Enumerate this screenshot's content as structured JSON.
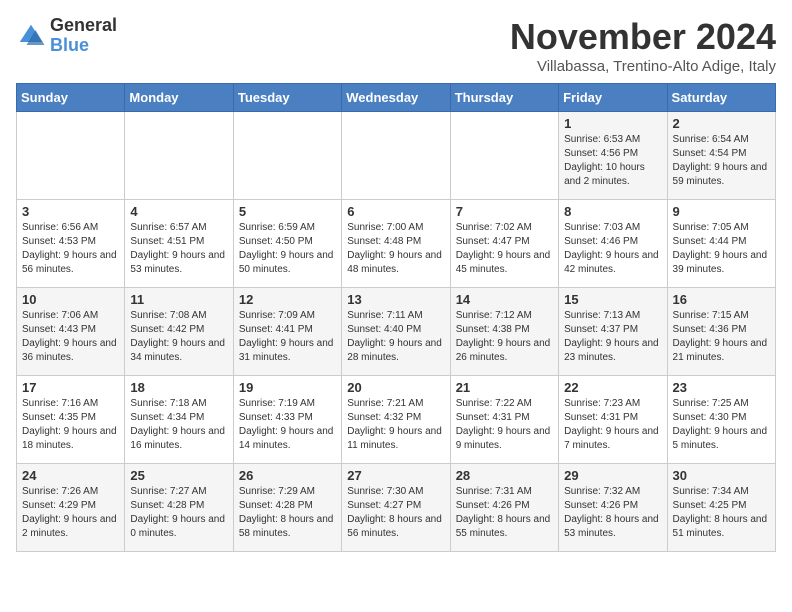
{
  "logo": {
    "general": "General",
    "blue": "Blue"
  },
  "title": "November 2024",
  "subtitle": "Villabassa, Trentino-Alto Adige, Italy",
  "days_header": [
    "Sunday",
    "Monday",
    "Tuesday",
    "Wednesday",
    "Thursday",
    "Friday",
    "Saturday"
  ],
  "weeks": [
    [
      {
        "day": "",
        "info": ""
      },
      {
        "day": "",
        "info": ""
      },
      {
        "day": "",
        "info": ""
      },
      {
        "day": "",
        "info": ""
      },
      {
        "day": "",
        "info": ""
      },
      {
        "day": "1",
        "info": "Sunrise: 6:53 AM\nSunset: 4:56 PM\nDaylight: 10 hours and 2 minutes."
      },
      {
        "day": "2",
        "info": "Sunrise: 6:54 AM\nSunset: 4:54 PM\nDaylight: 9 hours and 59 minutes."
      }
    ],
    [
      {
        "day": "3",
        "info": "Sunrise: 6:56 AM\nSunset: 4:53 PM\nDaylight: 9 hours and 56 minutes."
      },
      {
        "day": "4",
        "info": "Sunrise: 6:57 AM\nSunset: 4:51 PM\nDaylight: 9 hours and 53 minutes."
      },
      {
        "day": "5",
        "info": "Sunrise: 6:59 AM\nSunset: 4:50 PM\nDaylight: 9 hours and 50 minutes."
      },
      {
        "day": "6",
        "info": "Sunrise: 7:00 AM\nSunset: 4:48 PM\nDaylight: 9 hours and 48 minutes."
      },
      {
        "day": "7",
        "info": "Sunrise: 7:02 AM\nSunset: 4:47 PM\nDaylight: 9 hours and 45 minutes."
      },
      {
        "day": "8",
        "info": "Sunrise: 7:03 AM\nSunset: 4:46 PM\nDaylight: 9 hours and 42 minutes."
      },
      {
        "day": "9",
        "info": "Sunrise: 7:05 AM\nSunset: 4:44 PM\nDaylight: 9 hours and 39 minutes."
      }
    ],
    [
      {
        "day": "10",
        "info": "Sunrise: 7:06 AM\nSunset: 4:43 PM\nDaylight: 9 hours and 36 minutes."
      },
      {
        "day": "11",
        "info": "Sunrise: 7:08 AM\nSunset: 4:42 PM\nDaylight: 9 hours and 34 minutes."
      },
      {
        "day": "12",
        "info": "Sunrise: 7:09 AM\nSunset: 4:41 PM\nDaylight: 9 hours and 31 minutes."
      },
      {
        "day": "13",
        "info": "Sunrise: 7:11 AM\nSunset: 4:40 PM\nDaylight: 9 hours and 28 minutes."
      },
      {
        "day": "14",
        "info": "Sunrise: 7:12 AM\nSunset: 4:38 PM\nDaylight: 9 hours and 26 minutes."
      },
      {
        "day": "15",
        "info": "Sunrise: 7:13 AM\nSunset: 4:37 PM\nDaylight: 9 hours and 23 minutes."
      },
      {
        "day": "16",
        "info": "Sunrise: 7:15 AM\nSunset: 4:36 PM\nDaylight: 9 hours and 21 minutes."
      }
    ],
    [
      {
        "day": "17",
        "info": "Sunrise: 7:16 AM\nSunset: 4:35 PM\nDaylight: 9 hours and 18 minutes."
      },
      {
        "day": "18",
        "info": "Sunrise: 7:18 AM\nSunset: 4:34 PM\nDaylight: 9 hours and 16 minutes."
      },
      {
        "day": "19",
        "info": "Sunrise: 7:19 AM\nSunset: 4:33 PM\nDaylight: 9 hours and 14 minutes."
      },
      {
        "day": "20",
        "info": "Sunrise: 7:21 AM\nSunset: 4:32 PM\nDaylight: 9 hours and 11 minutes."
      },
      {
        "day": "21",
        "info": "Sunrise: 7:22 AM\nSunset: 4:31 PM\nDaylight: 9 hours and 9 minutes."
      },
      {
        "day": "22",
        "info": "Sunrise: 7:23 AM\nSunset: 4:31 PM\nDaylight: 9 hours and 7 minutes."
      },
      {
        "day": "23",
        "info": "Sunrise: 7:25 AM\nSunset: 4:30 PM\nDaylight: 9 hours and 5 minutes."
      }
    ],
    [
      {
        "day": "24",
        "info": "Sunrise: 7:26 AM\nSunset: 4:29 PM\nDaylight: 9 hours and 2 minutes."
      },
      {
        "day": "25",
        "info": "Sunrise: 7:27 AM\nSunset: 4:28 PM\nDaylight: 9 hours and 0 minutes."
      },
      {
        "day": "26",
        "info": "Sunrise: 7:29 AM\nSunset: 4:28 PM\nDaylight: 8 hours and 58 minutes."
      },
      {
        "day": "27",
        "info": "Sunrise: 7:30 AM\nSunset: 4:27 PM\nDaylight: 8 hours and 56 minutes."
      },
      {
        "day": "28",
        "info": "Sunrise: 7:31 AM\nSunset: 4:26 PM\nDaylight: 8 hours and 55 minutes."
      },
      {
        "day": "29",
        "info": "Sunrise: 7:32 AM\nSunset: 4:26 PM\nDaylight: 8 hours and 53 minutes."
      },
      {
        "day": "30",
        "info": "Sunrise: 7:34 AM\nSunset: 4:25 PM\nDaylight: 8 hours and 51 minutes."
      }
    ]
  ]
}
